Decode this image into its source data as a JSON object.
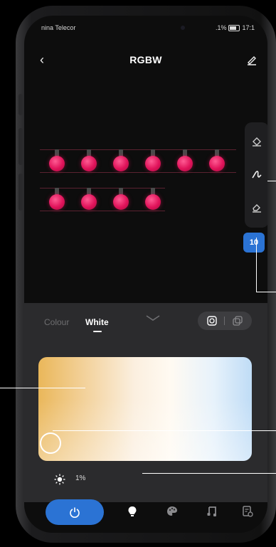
{
  "status_bar": {
    "carrier": "​nina Telecor",
    "battery_text": ".1%",
    "time": "17:1"
  },
  "header": {
    "title": "RGBW",
    "back_icon": "chevron-left-icon",
    "edit_icon": "pen-icon"
  },
  "bulbs": {
    "row1_count": 6,
    "row2_count": 4,
    "color": "#e0135a"
  },
  "tools": [
    {
      "name": "fill-icon"
    },
    {
      "name": "brush-icon"
    },
    {
      "name": "eraser-icon"
    }
  ],
  "selection_count": "10",
  "panel": {
    "tabs": [
      {
        "label": "Colour",
        "active": false
      },
      {
        "label": "White",
        "active": true
      }
    ],
    "mode_toggle_icons": [
      "refresh-mode-icon",
      "copy-mode-icon"
    ],
    "brightness_value": "1%"
  },
  "bottom_nav": {
    "items": [
      {
        "name": "power-icon",
        "active": true
      },
      {
        "name": "bulb-icon",
        "active": true
      },
      {
        "name": "palette-icon",
        "active": false
      },
      {
        "name": "music-icon",
        "active": false
      },
      {
        "name": "schedule-icon",
        "active": false
      }
    ]
  },
  "accent_color": "#2b73d4"
}
